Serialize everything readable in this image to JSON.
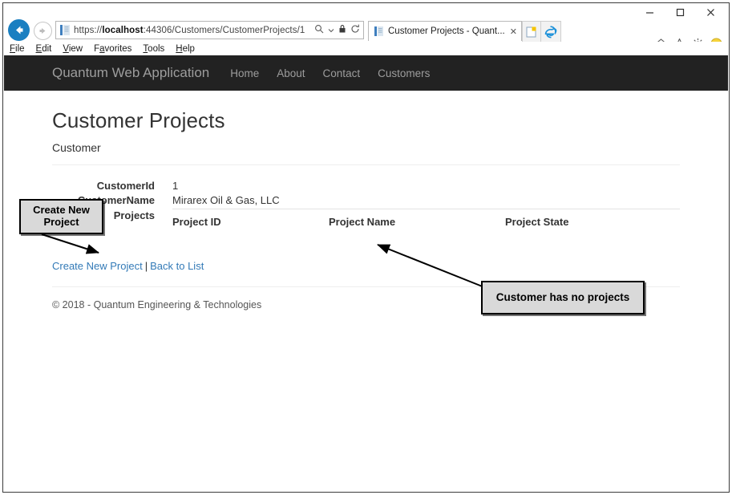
{
  "browser": {
    "window_controls": {
      "minimize": "minimize-icon",
      "maximize": "maximize-icon",
      "close": "close-icon"
    },
    "back_icon": "back-arrow-icon",
    "forward_icon": "forward-arrow-icon",
    "address": {
      "scheme": "https://",
      "host": "localhost",
      "path": ":44306/Customers/CustomerProjects/1",
      "full": "https://localhost:44306/Customers/CustomerProjects/1",
      "favicon": "page-icon",
      "search_icon": "search-icon",
      "dropdown_icon": "chevron-down-icon",
      "lock_icon": "lock-icon",
      "refresh_icon": "refresh-icon"
    },
    "tab": {
      "title": "Customer Projects - Quant...",
      "favicon": "page-icon",
      "close_label": "✕",
      "new_tab_icon": "new-tab-icon",
      "ie_logo_icon": "internet-explorer-icon"
    },
    "toolbar_icons": [
      "home-icon",
      "favorites-star-icon",
      "settings-gear-icon",
      "smiley-feedback-icon"
    ],
    "menubar": [
      {
        "label": "File",
        "accel": "F"
      },
      {
        "label": "Edit",
        "accel": "E"
      },
      {
        "label": "View",
        "accel": "V"
      },
      {
        "label": "Favorites",
        "accel": "a"
      },
      {
        "label": "Tools",
        "accel": "T"
      },
      {
        "label": "Help",
        "accel": "H"
      }
    ]
  },
  "site": {
    "brand": "Quantum Web Application",
    "nav_links": [
      "Home",
      "About",
      "Contact",
      "Customers"
    ],
    "navbar_bg": "#222222",
    "link_color": "#337ab7"
  },
  "page": {
    "title": "Customer Projects",
    "subtitle": "Customer",
    "details": [
      {
        "term": "CustomerId",
        "value": "1"
      },
      {
        "term": "CustomerName",
        "value": "Mirarex Oil & Gas, LLC"
      }
    ],
    "projects_label": "Projects",
    "table": {
      "columns": [
        "Project ID",
        "Project Name",
        "Project State"
      ],
      "rows": []
    },
    "actions": {
      "create_link": "Create New Project",
      "separator": "|",
      "back_link": "Back to List"
    },
    "footer": "© 2018 - Quantum Engineering & Technologies"
  },
  "annotations": [
    {
      "id": "create",
      "text": "Create New Project"
    },
    {
      "id": "noprojects",
      "text": "Customer has no projects"
    }
  ]
}
